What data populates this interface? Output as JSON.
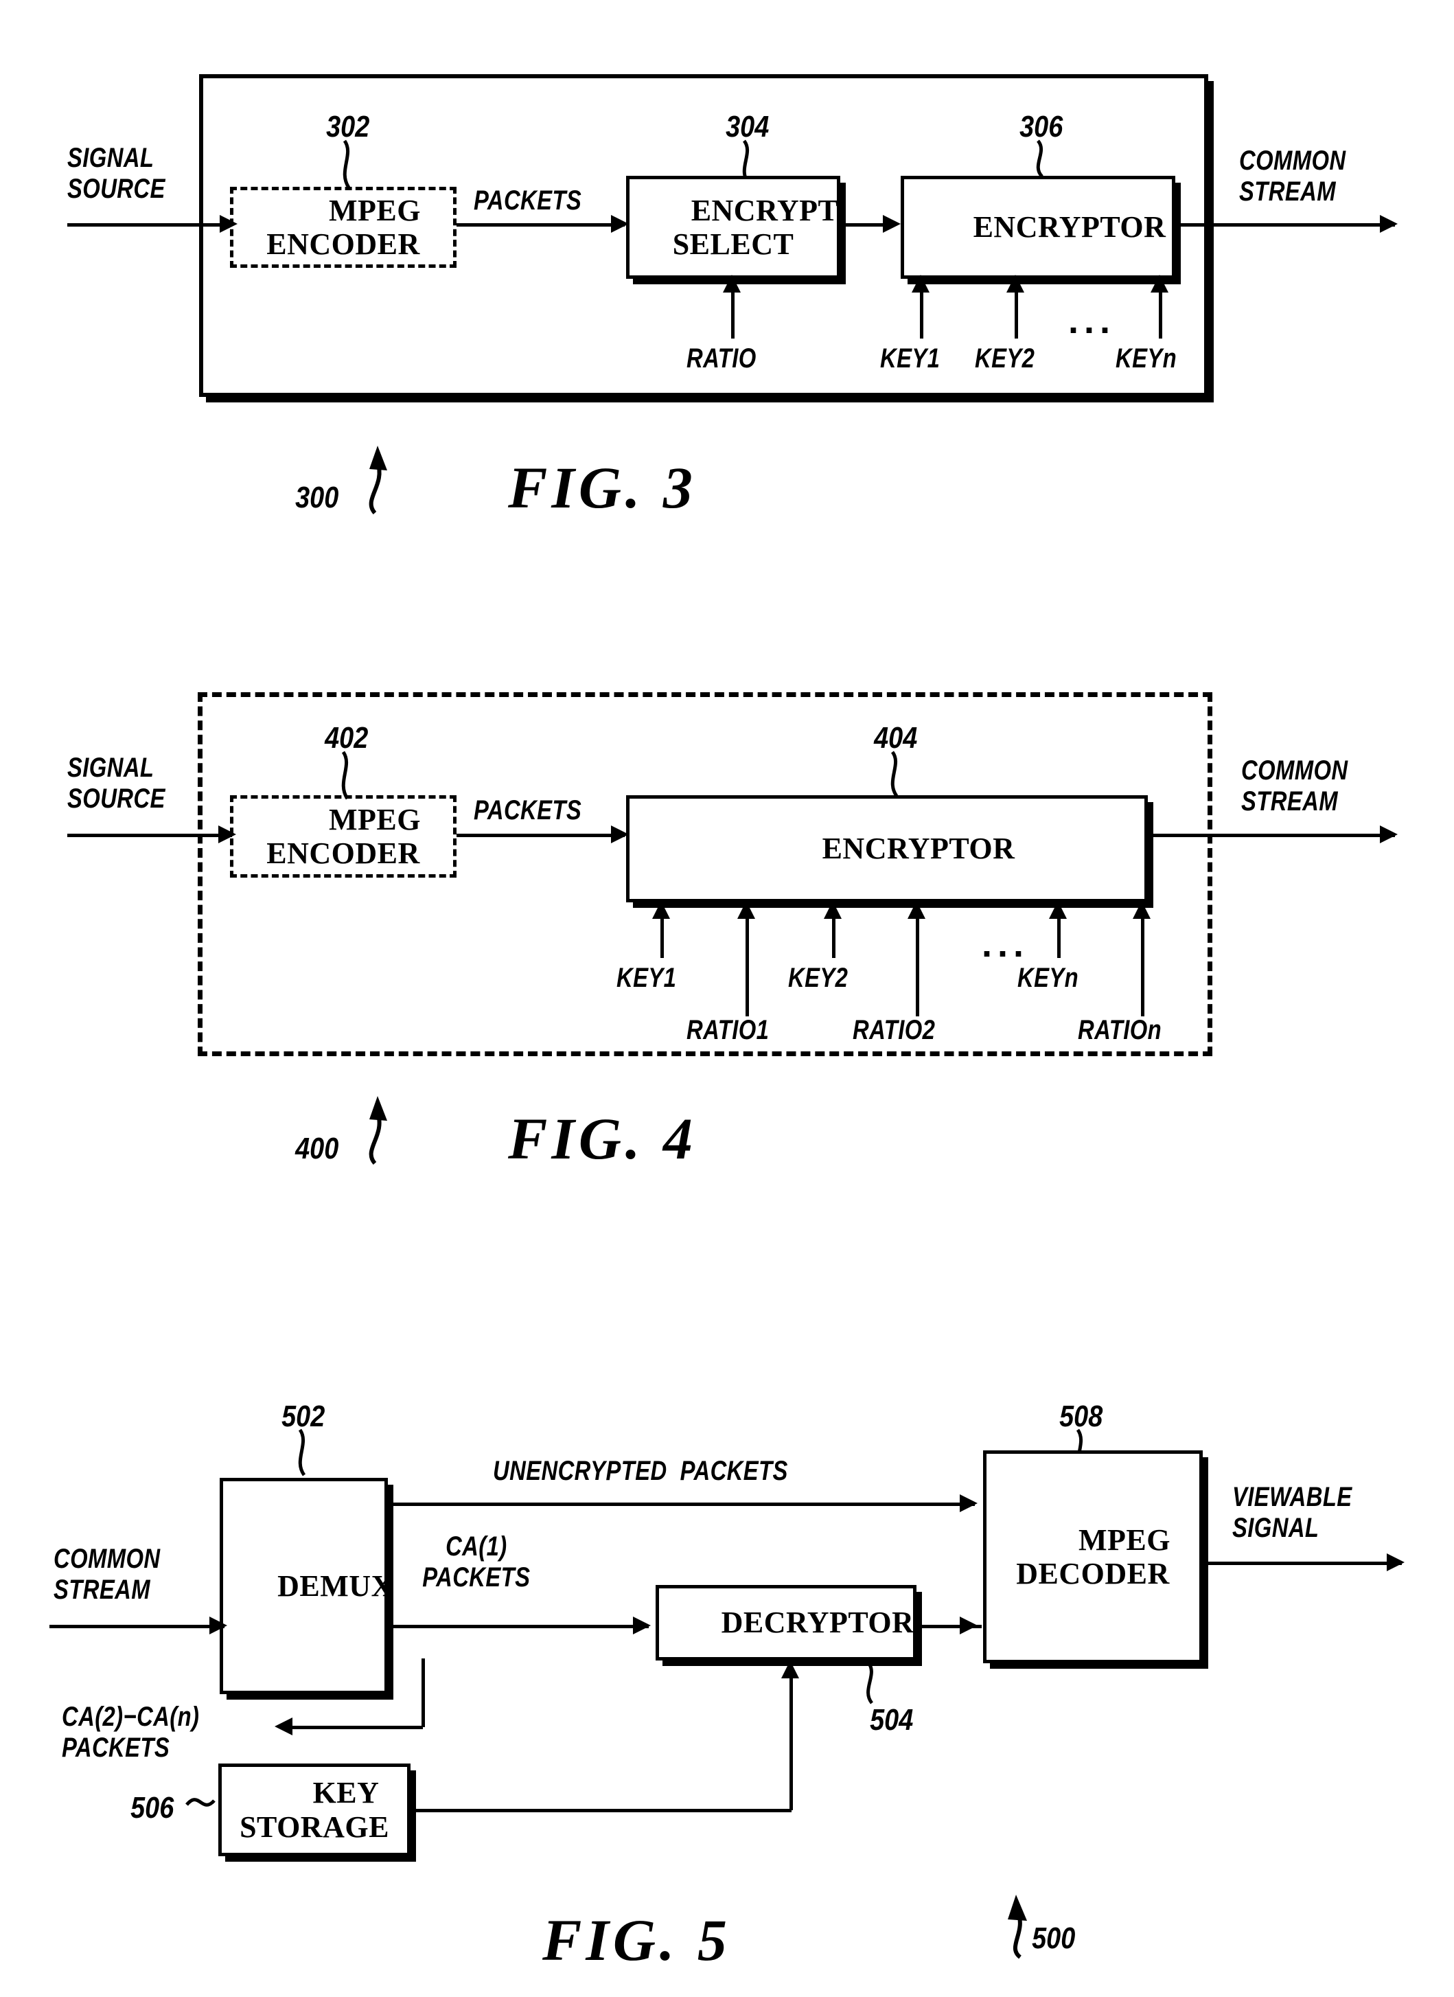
{
  "document": {
    "type": "patent-drawing-sheet",
    "figures": [
      "FIG. 3",
      "FIG. 4",
      "FIG. 5"
    ]
  },
  "fig3": {
    "caption": "FIG. 3",
    "system_ref": "300",
    "blocks": [
      {
        "ref": "302",
        "label_line1": "MPEG",
        "label_line2": "ENCODER",
        "style": "dashed"
      },
      {
        "ref": "304",
        "label_line1": "ENCRYPT",
        "label_line2": "SELECT",
        "style": "solid"
      },
      {
        "ref": "306",
        "label_line1": "ENCRYPTOR",
        "label_line2": "",
        "style": "solid"
      }
    ],
    "signals": {
      "input_line1": "SIGNAL",
      "input_line2": "SOURCE",
      "packets": "PACKETS",
      "output_line1": "COMMON",
      "output_line2": "STREAM",
      "ratio": "RATIO",
      "key1": "KEY1",
      "key2": "KEY2",
      "keyn": "KEYn",
      "ellipsis": "..."
    }
  },
  "fig4": {
    "caption": "FIG. 4",
    "system_ref": "400",
    "blocks": [
      {
        "ref": "402",
        "label_line1": "MPEG",
        "label_line2": "ENCODER",
        "style": "dashed"
      },
      {
        "ref": "404",
        "label_line1": "ENCRYPTOR",
        "label_line2": "",
        "style": "solid"
      }
    ],
    "signals": {
      "input_line1": "SIGNAL",
      "input_line2": "SOURCE",
      "packets": "PACKETS",
      "output_line1": "COMMON",
      "output_line2": "STREAM",
      "key1": "KEY1",
      "key2": "KEY2",
      "keyn": "KEYn",
      "ratio1": "RATIO1",
      "ratio2": "RATIO2",
      "ration": "RATIOn",
      "ellipsis": "..."
    }
  },
  "fig5": {
    "caption": "FIG. 5",
    "system_ref": "500",
    "blocks": [
      {
        "ref": "502",
        "label_line1": "DEMUX",
        "label_line2": "",
        "style": "solid"
      },
      {
        "ref": "504",
        "label_line1": "DECRYPTOR",
        "label_line2": "",
        "style": "solid"
      },
      {
        "ref": "506",
        "label_line1": "KEY",
        "label_line2": "STORAGE",
        "style": "solid"
      },
      {
        "ref": "508",
        "label_line1": "MPEG",
        "label_line2": "DECODER",
        "style": "solid"
      }
    ],
    "signals": {
      "input_line1": "COMMON",
      "input_line2": "STREAM",
      "unencrypted_packets": "UNENCRYPTED  PACKETS",
      "ca1_line1": "CA(1)",
      "ca1_line2": "PACKETS",
      "ca2n_line1": "CA(2)−CA(n)",
      "ca2n_line2": "PACKETS",
      "output_line1": "VIEWABLE",
      "output_line2": "SIGNAL"
    }
  }
}
